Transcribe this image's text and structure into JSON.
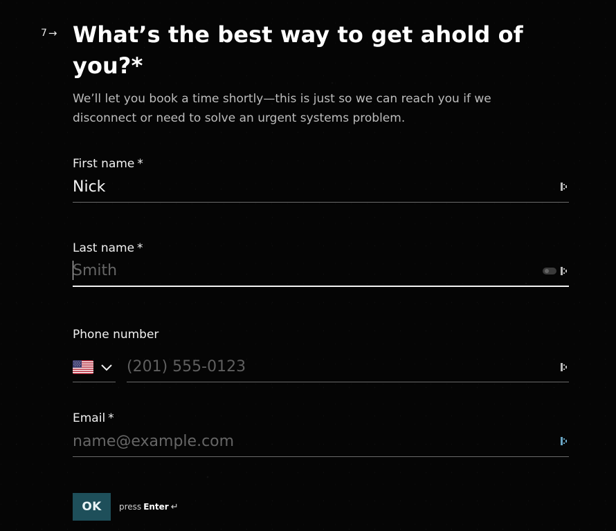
{
  "question": {
    "number": "7",
    "arrow_icon": "arrow-right-icon",
    "title": "What’s the best way to get ahold of you?*",
    "subtitle": "We’ll let you book a time shortly—this is just so we can reach you if we disconnect or need to solve an urgent systems problem."
  },
  "fields": [
    {
      "label": "First name",
      "required_mark": "*",
      "value": "Nick",
      "placeholder": ""
    },
    {
      "label": "Last name",
      "required_mark": "*",
      "value": "",
      "placeholder": "Smith"
    },
    {
      "label": "Email",
      "required_mark": "*",
      "value": "",
      "placeholder": "name@example.com"
    }
  ],
  "phone": {
    "label": "Phone number",
    "country_icon": "us-flag-icon",
    "dropdown_icon": "chevron-down-icon",
    "value": "",
    "placeholder": "(201) 555-0123"
  },
  "actions": {
    "ok_label": "OK",
    "hint_prefix": "press",
    "hint_key": "Enter",
    "hint_icon": "enter-icon"
  },
  "colors": {
    "background": "#050505",
    "text_primary": "#ffffff",
    "text_secondary": "#bdbdbd",
    "placeholder": "#666666",
    "underline": "#6b6b6b",
    "button_bg": "#1e4f5a",
    "button_text": "#e8f3f5"
  }
}
